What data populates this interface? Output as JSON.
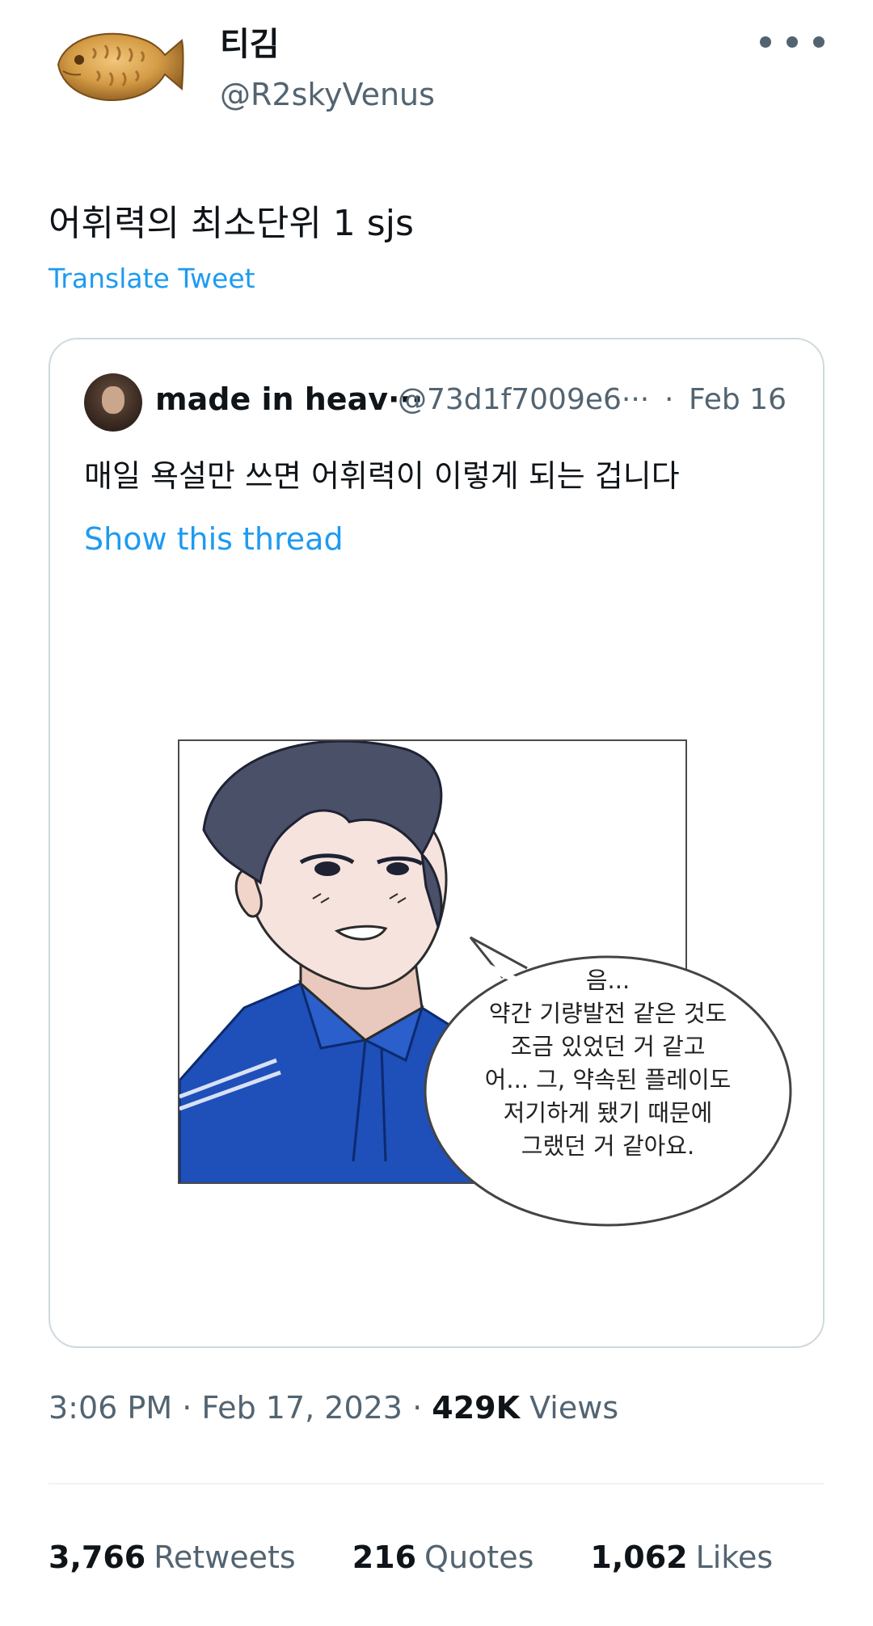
{
  "author": {
    "name": "티김",
    "handle": "@R2skyVenus"
  },
  "tweet": {
    "text": "어휘력의 최소단위 1 sjs",
    "translate_label": "Translate Tweet"
  },
  "quoted": {
    "name": "made in heav···",
    "handle": "@73d1f7009e6···",
    "separator": "·",
    "date": "Feb 16",
    "text": "매일 욕설만 쓰면 어휘력이 이렇게 되는 겁니다",
    "show_thread_label": "Show this thread",
    "speech_bubble": [
      "음...",
      "약간 기량발전 같은 것도",
      "조금 있었던 거 같고",
      "어... 그, 약속된 플레이도",
      "저기하게 됐기 때문에",
      "그랬던 거 같아요."
    ]
  },
  "meta": {
    "time": "3:06 PM",
    "date": "Feb 17, 2023",
    "sep": "·",
    "views_count": "429K",
    "views_label": "Views"
  },
  "stats": {
    "retweets_count": "3,766",
    "retweets_label": "Retweets",
    "quotes_count": "216",
    "quotes_label": "Quotes",
    "likes_count": "1,062",
    "likes_label": "Likes"
  },
  "colors": {
    "link": "#1d9bf0",
    "secondary_text": "#536471",
    "primary_text": "#0f1419",
    "border": "#cfd9de"
  }
}
